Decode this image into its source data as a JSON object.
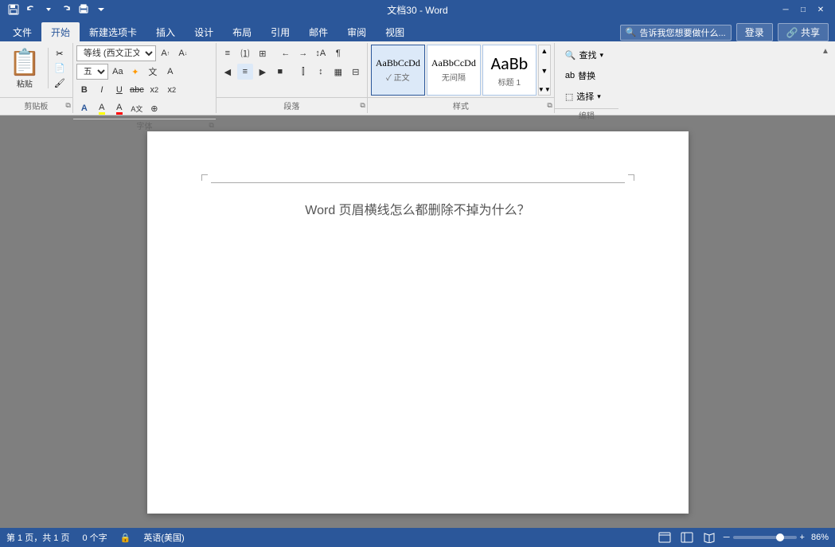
{
  "titleBar": {
    "title": "文档30 - Word",
    "quickAccess": [
      "save",
      "undo",
      "redo",
      "customize"
    ],
    "windowControls": [
      "minimize",
      "restore",
      "close"
    ]
  },
  "ribbonTabs": {
    "tabs": [
      "文件",
      "开始",
      "新建选项卡",
      "插入",
      "设计",
      "布局",
      "引用",
      "邮件",
      "审阅",
      "视图"
    ],
    "activeTab": "开始",
    "searchPlaceholder": "告诉我您想要做什么...",
    "rightButtons": [
      "登录",
      "共享"
    ]
  },
  "clipboard": {
    "label": "剪贴板",
    "pasteLabel": "粘贴",
    "subItems": [
      "剪切",
      "复制",
      "格式刷"
    ]
  },
  "font": {
    "label": "字体",
    "name": "等线 (西文正文",
    "size": "五号",
    "formatButtons": [
      "A↑",
      "A↓",
      "Aa",
      "✦",
      "文",
      "A"
    ],
    "styleButtons": [
      "B",
      "I",
      "U",
      "abc",
      "x₂",
      "x²"
    ],
    "colorButtons": [
      "A",
      "A",
      "A",
      "A",
      "⊕"
    ]
  },
  "paragraph": {
    "label": "段落",
    "listButtons": [
      "≡",
      "≡↓",
      "≡↑",
      "←→",
      "↕",
      "↔",
      "↕↓"
    ],
    "alignButtons": [
      "◀",
      "≡",
      "▶",
      "■"
    ],
    "indentButtons": [
      "←",
      "→"
    ],
    "spacingButtons": [
      "↕",
      "▦",
      "⊟"
    ]
  },
  "styles": {
    "label": "样式",
    "items": [
      {
        "name": "正文",
        "preview": "AaBbCcDd",
        "active": true
      },
      {
        "name": "无间隔",
        "preview": "AaBbCcDd",
        "active": false
      },
      {
        "name": "标题 1",
        "preview": "AaBb",
        "active": false
      }
    ]
  },
  "editing": {
    "label": "编辑",
    "buttons": [
      "查找",
      "替换",
      "选择"
    ]
  },
  "document": {
    "title": "Word 页眉横线怎么都删除不掉为什么？",
    "pages": 1,
    "totalPages": 1,
    "wordCount": 0,
    "language": "英语(美国)"
  },
  "statusBar": {
    "pageInfo": "第 1 页，共 1 页",
    "wordCount": "0 个字",
    "language": "英语(美国)",
    "zoomLevel": "86%"
  },
  "colors": {
    "ribbonBlue": "#2b579a",
    "toolbarBg": "#f0f0f0",
    "docBg": "#7f7f7f",
    "pageBg": "#ffffff",
    "activeStyle": "#dce9f8"
  }
}
